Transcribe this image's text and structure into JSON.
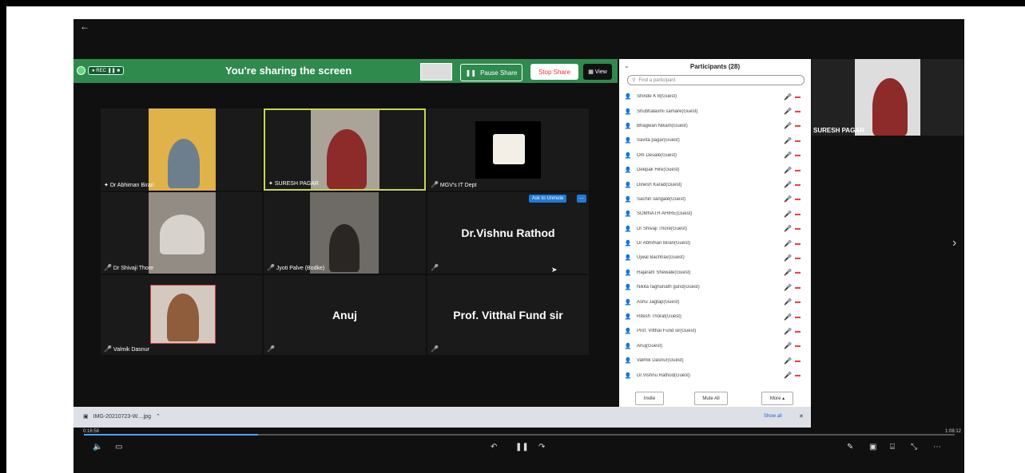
{
  "nav": {
    "back": "←"
  },
  "sharebar": {
    "title": "You're sharing the screen",
    "rec_label": "● REC ❚❚ ■",
    "pause_label": "Pause Share",
    "stop_label": "Stop Share",
    "view_label": "View"
  },
  "tiles": [
    {
      "label": "Dr Abhiman Birari",
      "type": "video"
    },
    {
      "label": "SURESH PAGAR",
      "type": "video"
    },
    {
      "label": "MGV's IT Dept",
      "type": "video"
    },
    {
      "label": "Dr Shivaji Thore",
      "type": "video"
    },
    {
      "label": "Jyoti Palve (Bodke)",
      "type": "video"
    },
    {
      "label": "",
      "name": "Dr.Vishnu Rathod",
      "type": "name"
    },
    {
      "label": "Valmik Dasnur",
      "type": "video"
    },
    {
      "label": "",
      "name": "Anuj",
      "type": "name"
    },
    {
      "label": "",
      "name": "Prof. Vitthal Fund sir",
      "type": "name"
    }
  ],
  "ask_unmute": "Ask to Unmute",
  "ask_more": "...",
  "participants": {
    "title": "Participants (28)",
    "search_placeholder": "Find a participant",
    "items": [
      "Shinde K B(Guest)",
      "Shubhalaxmi samare(Guest)",
      "Bhagwan Nikam(Guest)",
      "Savita pagar(Guest)",
      "Om Desale(Guest)",
      "Deepak Hire(Guest)",
      "Dinesh Karad(Guest)",
      "Sachin sangale(Guest)",
      "SOMNATH AHIRE(Guest)",
      "Dr Shivaji Thore(Guest)",
      "Dr Abhiman Birari(Guest)",
      "Ujwal Bachhav(Guest)",
      "Rajaram Shewale(Guest)",
      "Nikita raghunath gund(Guest)",
      "Ashu Jagtap(Guest)",
      "Ritesh Thorat(Guest)",
      "Prof. Vitthal Fund sir(Guest)",
      "Anuj(Guest)",
      "Valmik Dasnur(Guest)",
      "Dr.Vishnu Rathod(Guest)"
    ],
    "invite": "Invite",
    "mute_all": "Mute All",
    "more": "More ▴"
  },
  "right_video": {
    "label": "SURESH PAGAR"
  },
  "download": {
    "file": "IMG-20210723-W....jpg",
    "show_all": "Show all",
    "close": "✕"
  },
  "player": {
    "elapsed": "0:16:58",
    "total": "1:08:12",
    "progress": 0.2
  }
}
